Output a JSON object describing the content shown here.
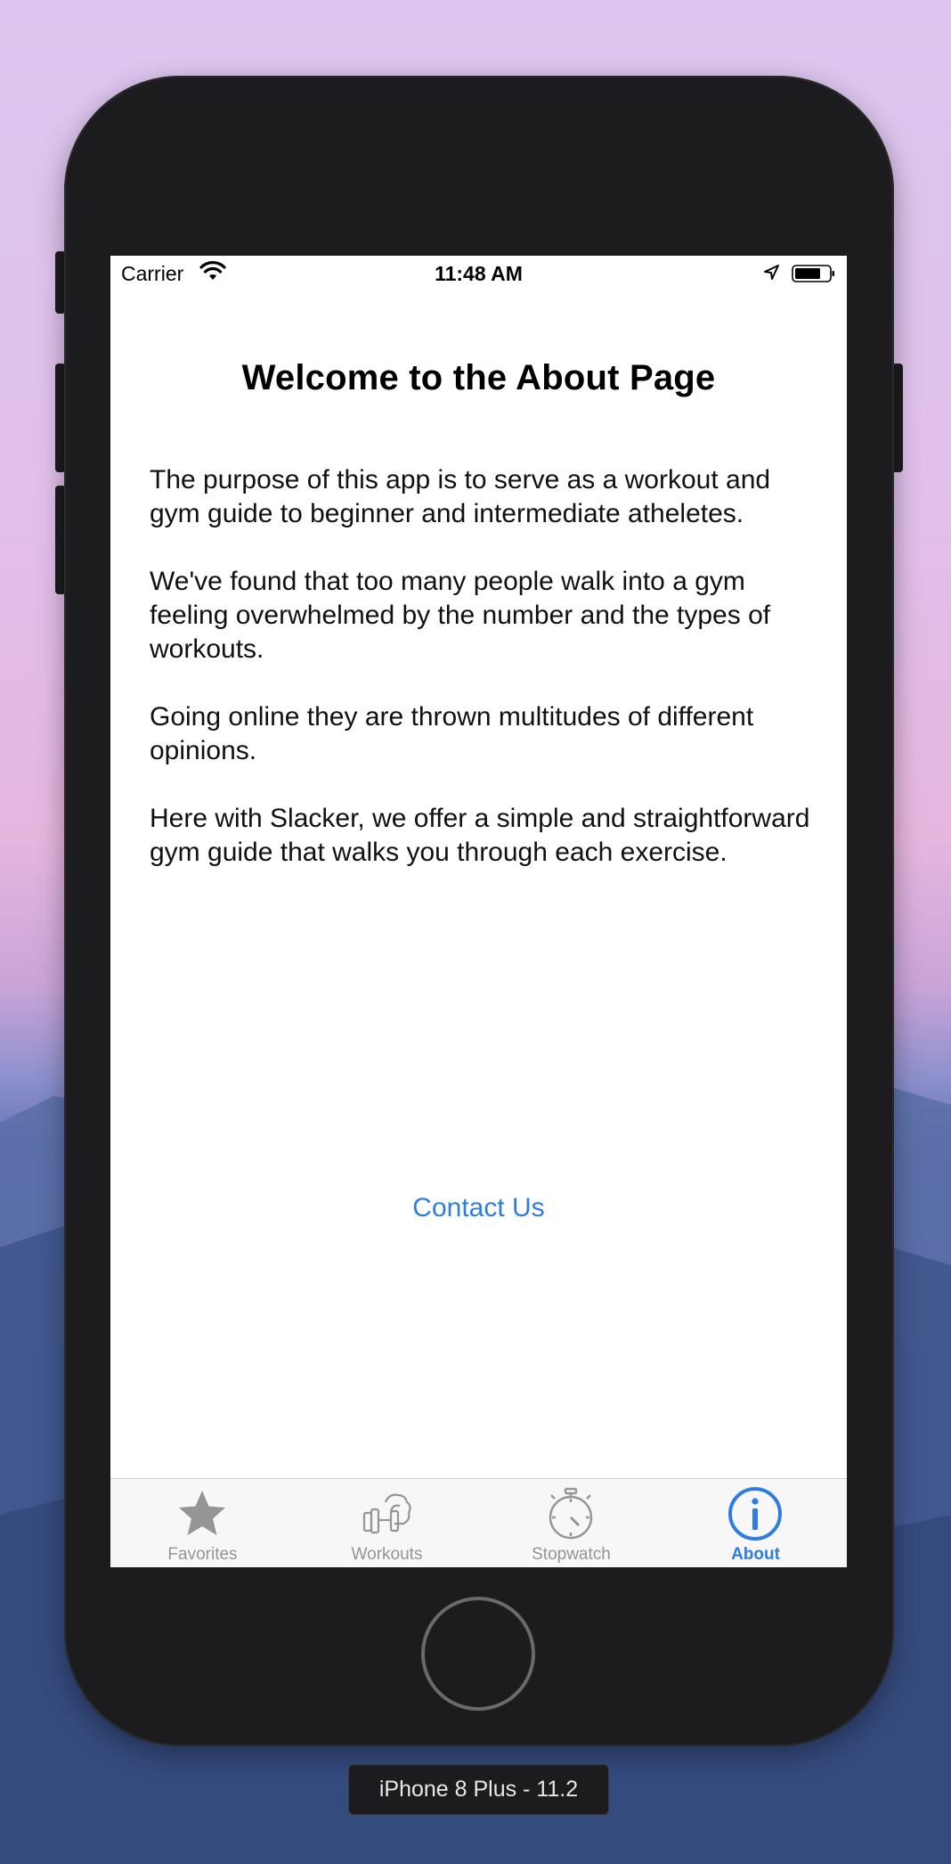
{
  "status_bar": {
    "carrier": "Carrier",
    "time": "11:48 AM"
  },
  "about": {
    "title": "Welcome to the About Page",
    "paragraphs": [
      "The purpose of this app is to serve as a workout and gym guide to beginner and intermediate atheletes.",
      "We've found that too many people walk into a gym feeling overwhelmed by the number and the types of workouts.",
      "Going online they are thrown multitudes of different opinions.",
      "Here with Slacker, we offer a simple and straightforward gym guide that walks you through each exercise."
    ],
    "contact_label": "Contact Us"
  },
  "tab_bar": {
    "tabs": [
      {
        "label": "Favorites",
        "icon": "star-icon",
        "selected": false
      },
      {
        "label": "Workouts",
        "icon": "dumbbell-icon",
        "selected": false
      },
      {
        "label": "Stopwatch",
        "icon": "stopwatch-icon",
        "selected": false
      },
      {
        "label": "About",
        "icon": "info-icon",
        "selected": true
      }
    ]
  },
  "device_label": "iPhone 8 Plus - 11.2",
  "colors": {
    "accent": "#2f7de1",
    "inactive_tab": "#959595",
    "device_body": "#1c1c1e"
  }
}
